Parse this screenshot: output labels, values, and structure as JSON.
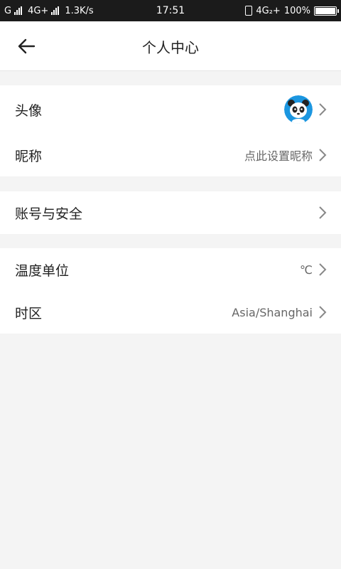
{
  "status_bar": {
    "carrier1": "G",
    "network1": "4G+",
    "speed": "1.3K/s",
    "time": "17:51",
    "network2": "4G₂+",
    "battery": "100%"
  },
  "header": {
    "title": "个人中心"
  },
  "sections": {
    "profile": {
      "avatar_label": "头像",
      "nickname_label": "昵称",
      "nickname_value": "点此设置昵称"
    },
    "account": {
      "label": "账号与安全"
    },
    "settings": {
      "temp_label": "温度单位",
      "temp_value": "℃",
      "tz_label": "时区",
      "tz_value": "Asia/Shanghai"
    }
  },
  "colors": {
    "background": "#f4f4f4",
    "card": "#ffffff",
    "avatar_blue": "#1b96e0"
  }
}
